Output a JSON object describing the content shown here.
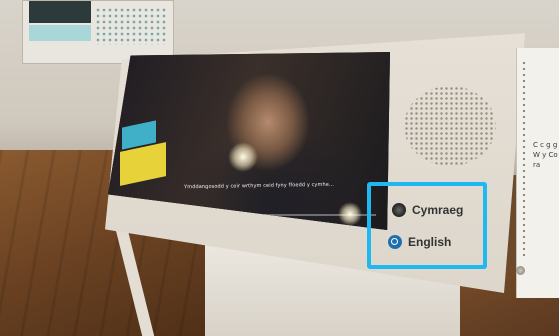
{
  "video": {
    "subtitle": "Ymddangosodd y ceir wrthym ceid fyny ffoedd y cymhe...",
    "progress": 0.45
  },
  "language_buttons": [
    {
      "label": "Cymraeg",
      "icon": "dragon-icon"
    },
    {
      "label": "English",
      "icon": "globe-icon"
    }
  ],
  "side_panel": {
    "text": "C c g g W y Co ra"
  },
  "colors": {
    "highlight": "#1fb8f0",
    "kiosk": "#e2dcd2"
  }
}
